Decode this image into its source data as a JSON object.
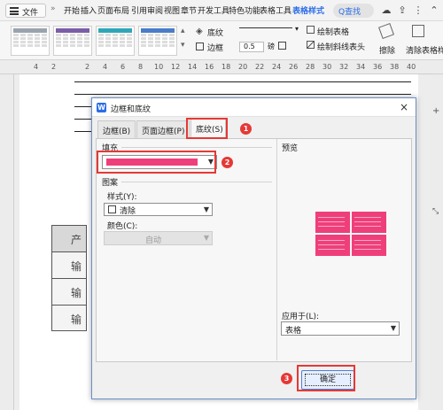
{
  "menubar": {
    "file_label": "文件",
    "more_label": "»",
    "items": [
      "开始",
      "插入",
      "页面布局",
      "引用",
      "审阅",
      "视图",
      "章节",
      "开发工具",
      "特色功能",
      "表格工具",
      "表格样式"
    ],
    "search_label": "Q查找"
  },
  "ribbon": {
    "shading_label": "底纹",
    "border_label": "边框",
    "line_width_value": "0.5",
    "line_width_unit": "磅",
    "draw_table_label": "绘制表格",
    "draw_diagonal_label": "绘制斜线表头",
    "erase_label": "擦除",
    "clear_style_label": "清除表格样"
  },
  "ruler_ticks": [
    "4",
    "2",
    "2",
    "4",
    "6",
    "8",
    "10",
    "12",
    "14",
    "16",
    "18",
    "20",
    "22",
    "24",
    "26",
    "28",
    "30",
    "32",
    "34",
    "36",
    "38",
    "40"
  ],
  "document": {
    "cells": [
      "产",
      "输",
      "输",
      "输"
    ]
  },
  "dialog": {
    "title": "边框和底纹",
    "close_glyph": "×",
    "tabs": [
      "边框(B)",
      "页面边框(P)",
      "底纹(S)"
    ],
    "fill_label": "填充",
    "fill_color": "#ef3f7a",
    "pattern_label": "图案",
    "style_label": "样式(Y):",
    "style_value": "清除",
    "color_label": "颜色(C):",
    "color_value": "自动",
    "preview_label": "预览",
    "apply_label": "应用于(L):",
    "apply_value": "表格",
    "ok_label": "确定"
  },
  "annotations": {
    "badges": [
      "1",
      "2",
      "3"
    ],
    "color": "#e53935"
  }
}
